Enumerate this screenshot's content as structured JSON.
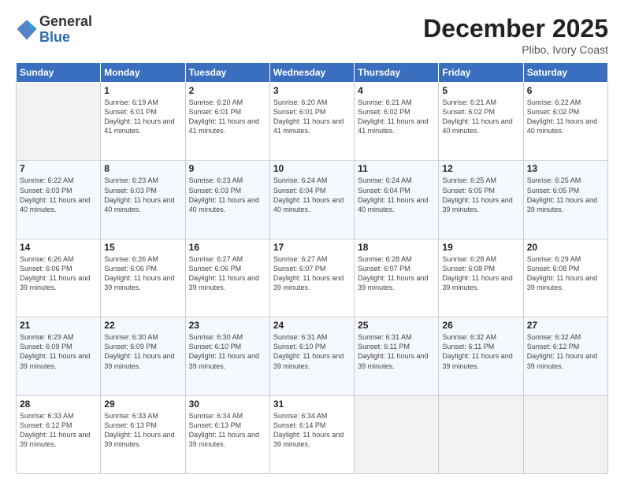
{
  "logo": {
    "general": "General",
    "blue": "Blue"
  },
  "header": {
    "month": "December 2025",
    "location": "Plibo, Ivory Coast"
  },
  "weekdays": [
    "Sunday",
    "Monday",
    "Tuesday",
    "Wednesday",
    "Thursday",
    "Friday",
    "Saturday"
  ],
  "weeks": [
    [
      {
        "day": "",
        "sunrise": "",
        "sunset": "",
        "daylight": ""
      },
      {
        "day": "1",
        "sunrise": "Sunrise: 6:19 AM",
        "sunset": "Sunset: 6:01 PM",
        "daylight": "Daylight: 11 hours and 41 minutes."
      },
      {
        "day": "2",
        "sunrise": "Sunrise: 6:20 AM",
        "sunset": "Sunset: 6:01 PM",
        "daylight": "Daylight: 11 hours and 41 minutes."
      },
      {
        "day": "3",
        "sunrise": "Sunrise: 6:20 AM",
        "sunset": "Sunset: 6:01 PM",
        "daylight": "Daylight: 11 hours and 41 minutes."
      },
      {
        "day": "4",
        "sunrise": "Sunrise: 6:21 AM",
        "sunset": "Sunset: 6:02 PM",
        "daylight": "Daylight: 11 hours and 41 minutes."
      },
      {
        "day": "5",
        "sunrise": "Sunrise: 6:21 AM",
        "sunset": "Sunset: 6:02 PM",
        "daylight": "Daylight: 11 hours and 40 minutes."
      },
      {
        "day": "6",
        "sunrise": "Sunrise: 6:22 AM",
        "sunset": "Sunset: 6:02 PM",
        "daylight": "Daylight: 11 hours and 40 minutes."
      }
    ],
    [
      {
        "day": "7",
        "sunrise": "Sunrise: 6:22 AM",
        "sunset": "Sunset: 6:03 PM",
        "daylight": "Daylight: 11 hours and 40 minutes."
      },
      {
        "day": "8",
        "sunrise": "Sunrise: 6:23 AM",
        "sunset": "Sunset: 6:03 PM",
        "daylight": "Daylight: 11 hours and 40 minutes."
      },
      {
        "day": "9",
        "sunrise": "Sunrise: 6:23 AM",
        "sunset": "Sunset: 6:03 PM",
        "daylight": "Daylight: 11 hours and 40 minutes."
      },
      {
        "day": "10",
        "sunrise": "Sunrise: 6:24 AM",
        "sunset": "Sunset: 6:04 PM",
        "daylight": "Daylight: 11 hours and 40 minutes."
      },
      {
        "day": "11",
        "sunrise": "Sunrise: 6:24 AM",
        "sunset": "Sunset: 6:04 PM",
        "daylight": "Daylight: 11 hours and 40 minutes."
      },
      {
        "day": "12",
        "sunrise": "Sunrise: 6:25 AM",
        "sunset": "Sunset: 6:05 PM",
        "daylight": "Daylight: 11 hours and 39 minutes."
      },
      {
        "day": "13",
        "sunrise": "Sunrise: 6:25 AM",
        "sunset": "Sunset: 6:05 PM",
        "daylight": "Daylight: 11 hours and 39 minutes."
      }
    ],
    [
      {
        "day": "14",
        "sunrise": "Sunrise: 6:26 AM",
        "sunset": "Sunset: 6:06 PM",
        "daylight": "Daylight: 11 hours and 39 minutes."
      },
      {
        "day": "15",
        "sunrise": "Sunrise: 6:26 AM",
        "sunset": "Sunset: 6:06 PM",
        "daylight": "Daylight: 11 hours and 39 minutes."
      },
      {
        "day": "16",
        "sunrise": "Sunrise: 6:27 AM",
        "sunset": "Sunset: 6:06 PM",
        "daylight": "Daylight: 11 hours and 39 minutes."
      },
      {
        "day": "17",
        "sunrise": "Sunrise: 6:27 AM",
        "sunset": "Sunset: 6:07 PM",
        "daylight": "Daylight: 11 hours and 39 minutes."
      },
      {
        "day": "18",
        "sunrise": "Sunrise: 6:28 AM",
        "sunset": "Sunset: 6:07 PM",
        "daylight": "Daylight: 11 hours and 39 minutes."
      },
      {
        "day": "19",
        "sunrise": "Sunrise: 6:28 AM",
        "sunset": "Sunset: 6:08 PM",
        "daylight": "Daylight: 11 hours and 39 minutes."
      },
      {
        "day": "20",
        "sunrise": "Sunrise: 6:29 AM",
        "sunset": "Sunset: 6:08 PM",
        "daylight": "Daylight: 11 hours and 39 minutes."
      }
    ],
    [
      {
        "day": "21",
        "sunrise": "Sunrise: 6:29 AM",
        "sunset": "Sunset: 6:09 PM",
        "daylight": "Daylight: 11 hours and 39 minutes."
      },
      {
        "day": "22",
        "sunrise": "Sunrise: 6:30 AM",
        "sunset": "Sunset: 6:09 PM",
        "daylight": "Daylight: 11 hours and 39 minutes."
      },
      {
        "day": "23",
        "sunrise": "Sunrise: 6:30 AM",
        "sunset": "Sunset: 6:10 PM",
        "daylight": "Daylight: 11 hours and 39 minutes."
      },
      {
        "day": "24",
        "sunrise": "Sunrise: 6:31 AM",
        "sunset": "Sunset: 6:10 PM",
        "daylight": "Daylight: 11 hours and 39 minutes."
      },
      {
        "day": "25",
        "sunrise": "Sunrise: 6:31 AM",
        "sunset": "Sunset: 6:11 PM",
        "daylight": "Daylight: 11 hours and 39 minutes."
      },
      {
        "day": "26",
        "sunrise": "Sunrise: 6:32 AM",
        "sunset": "Sunset: 6:11 PM",
        "daylight": "Daylight: 11 hours and 39 minutes."
      },
      {
        "day": "27",
        "sunrise": "Sunrise: 6:32 AM",
        "sunset": "Sunset: 6:12 PM",
        "daylight": "Daylight: 11 hours and 39 minutes."
      }
    ],
    [
      {
        "day": "28",
        "sunrise": "Sunrise: 6:33 AM",
        "sunset": "Sunset: 6:12 PM",
        "daylight": "Daylight: 11 hours and 39 minutes."
      },
      {
        "day": "29",
        "sunrise": "Sunrise: 6:33 AM",
        "sunset": "Sunset: 6:13 PM",
        "daylight": "Daylight: 11 hours and 39 minutes."
      },
      {
        "day": "30",
        "sunrise": "Sunrise: 6:34 AM",
        "sunset": "Sunset: 6:13 PM",
        "daylight": "Daylight: 11 hours and 39 minutes."
      },
      {
        "day": "31",
        "sunrise": "Sunrise: 6:34 AM",
        "sunset": "Sunset: 6:14 PM",
        "daylight": "Daylight: 11 hours and 39 minutes."
      },
      {
        "day": "",
        "sunrise": "",
        "sunset": "",
        "daylight": ""
      },
      {
        "day": "",
        "sunrise": "",
        "sunset": "",
        "daylight": ""
      },
      {
        "day": "",
        "sunrise": "",
        "sunset": "",
        "daylight": ""
      }
    ]
  ]
}
